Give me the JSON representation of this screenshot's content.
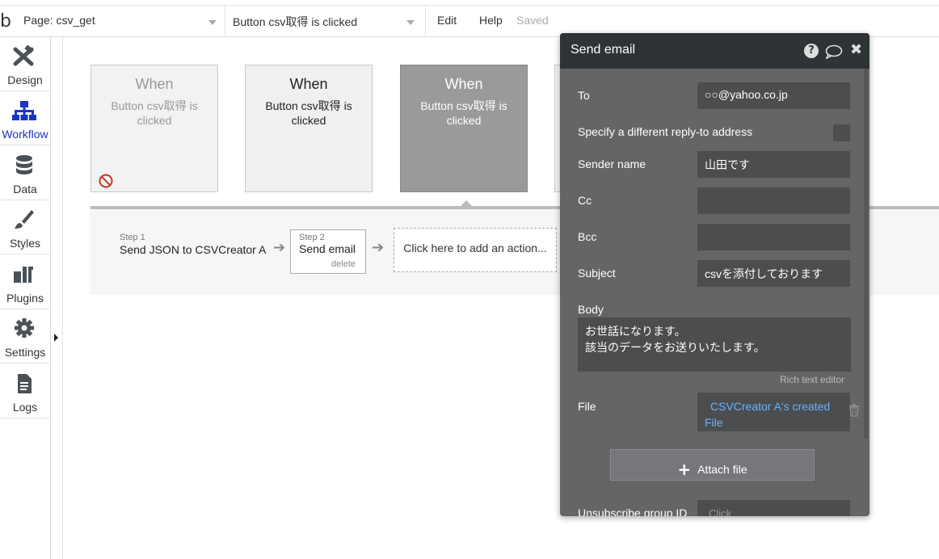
{
  "topbar": {
    "logo": "b",
    "page_selector": "Page: csv_get",
    "event_selector": "Button csv取得 is clicked",
    "menu_edit": "Edit",
    "menu_help": "Help",
    "status": "Saved"
  },
  "sidebar": {
    "items": [
      {
        "label": "Design",
        "icon": "design-icon"
      },
      {
        "label": "Workflow",
        "icon": "workflow-icon"
      },
      {
        "label": "Data",
        "icon": "database-icon"
      },
      {
        "label": "Styles",
        "icon": "brush-icon"
      },
      {
        "label": "Plugins",
        "icon": "plugin-icon"
      },
      {
        "label": "Settings",
        "icon": "gear-icon"
      },
      {
        "label": "Logs",
        "icon": "document-icon"
      }
    ],
    "active": "Workflow"
  },
  "events": [
    {
      "when": "When",
      "desc": "Button csv取得 is clicked",
      "state": "disabled"
    },
    {
      "when": "When",
      "desc": "Button csv取得 is clicked",
      "state": "normal"
    },
    {
      "when": "When",
      "desc": "Button csv取得 is clicked",
      "state": "selected"
    }
  ],
  "steps": [
    {
      "number": "Step 1",
      "title": "Send JSON to CSVCreator A"
    },
    {
      "number": "Step 2",
      "title": "Send email",
      "delete": "delete"
    }
  ],
  "add_action": "Click here to add an action...",
  "panel": {
    "title": "Send email",
    "fields": {
      "to_label": "To",
      "to_value": "○○@yahoo.co.jp",
      "reply_to_label": "Specify a different reply-to address",
      "sender_label": "Sender name",
      "sender_value": "山田です",
      "cc_label": "Cc",
      "cc_value": "",
      "bcc_label": "Bcc",
      "bcc_value": "",
      "subject_label": "Subject",
      "subject_value": "csvを添付しております",
      "body_label": "Body",
      "body_line1": "お世話になります。",
      "body_line2": "該当のデータをお送りいたします。",
      "rich_text": "Rich text editor",
      "file_label": "File",
      "file_value": "CSVCreator A's created File",
      "attach_button": "Attach file",
      "unsub_label": "Unsubscribe group ID",
      "unsub_placeholder": "Click"
    }
  },
  "colors": {
    "accent": "#1a36c9",
    "panel_bg": "#636567",
    "panel_header": "#2e3336",
    "field_bg": "#4b4d4f",
    "link": "#6cb0ff"
  }
}
